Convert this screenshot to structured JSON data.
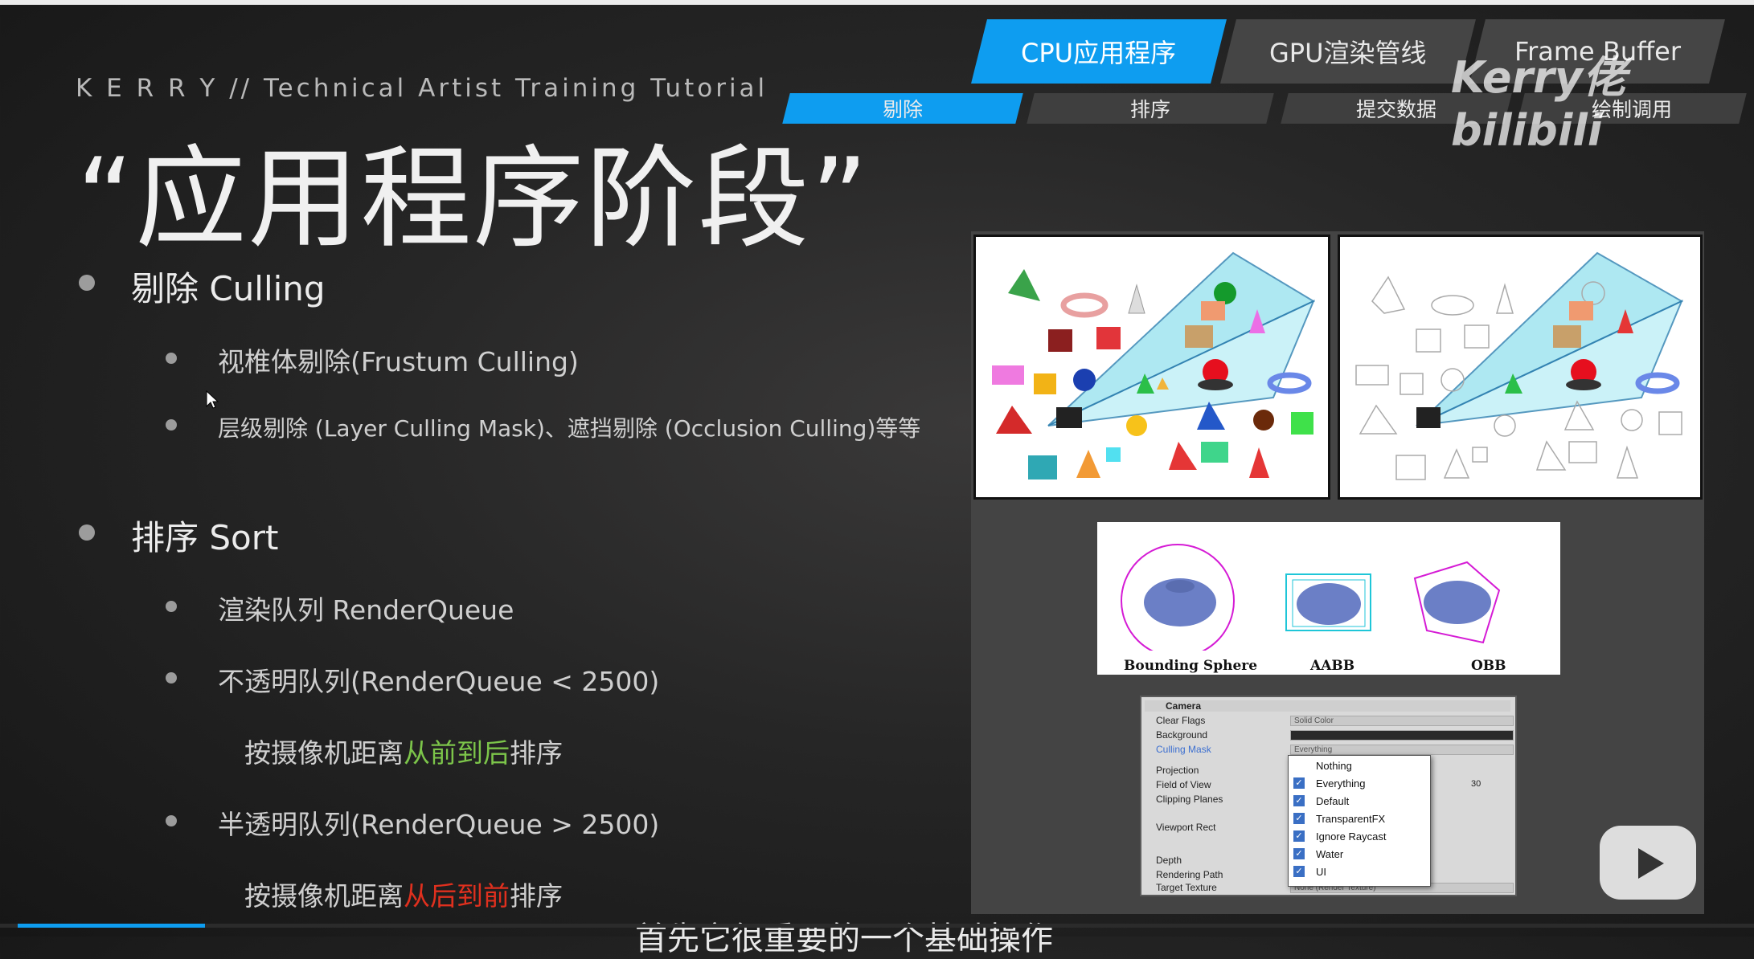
{
  "header": {
    "brand_line": "K E R R Y //  Technical Artist Training Tutorial",
    "title": "“应用程序阶段”",
    "watermark": "Kerry佬 bilibili"
  },
  "tabs": [
    {
      "label": "CPU应用程序",
      "active": true
    },
    {
      "label": "GPU渲染管线",
      "active": false
    },
    {
      "label": "Frame Buffer",
      "active": false
    }
  ],
  "subtabs": [
    {
      "label": "剔除",
      "active": true
    },
    {
      "label": "排序",
      "active": false
    },
    {
      "label": "提交数据",
      "active": false
    },
    {
      "label": "绘制调用",
      "active": false
    }
  ],
  "content": {
    "culling": {
      "heading": "剔除 Culling",
      "items": [
        "视椎体剔除(Frustum Culling)",
        "层级剔除 (Layer Culling Mask)、遮挡剔除 (Occlusion Culling)等等"
      ]
    },
    "sort": {
      "heading": "排序 Sort",
      "render_queue": "渲染队列 RenderQueue",
      "opaque": "不透明队列(RenderQueue < 2500)",
      "opaque_note_pre": "按摄像机距离",
      "opaque_note_hl": "从前到后",
      "opaque_note_post": "排序",
      "transparent": "半透明队列(RenderQueue > 2500)",
      "transparent_note_pre": "按摄像机距离",
      "transparent_note_hl": "从后到前",
      "transparent_note_post": "排序"
    }
  },
  "bounding_volumes": [
    "Bounding Sphere",
    "AABB",
    "OBB"
  ],
  "inspector": {
    "component": "Camera",
    "fields": [
      {
        "label": "Clear Flags",
        "value": "Solid Color"
      },
      {
        "label": "Background",
        "value": ""
      },
      {
        "label": "Culling Mask",
        "value": "Everything"
      },
      {
        "label": "Projection",
        "value": ""
      },
      {
        "label": "Field of View",
        "value": "30"
      },
      {
        "label": "Clipping Planes",
        "value": ""
      },
      {
        "label": "Viewport Rect",
        "value": ""
      },
      {
        "label": "Depth",
        "value": ""
      },
      {
        "label": "Rendering Path",
        "value": ""
      },
      {
        "label": "Target Texture",
        "value": "None (Render Texture)"
      }
    ],
    "dropdown": [
      {
        "label": "Nothing",
        "checked": false
      },
      {
        "label": "Everything",
        "checked": true
      },
      {
        "label": "Default",
        "checked": true
      },
      {
        "label": "TransparentFX",
        "checked": true
      },
      {
        "label": "Ignore Raycast",
        "checked": true
      },
      {
        "label": "Water",
        "checked": true
      },
      {
        "label": "UI",
        "checked": true
      }
    ]
  },
  "subtitle": "首先它很重要的一个基础操作",
  "colors": {
    "accent": "#0e9df0",
    "green_hl": "#7cc54a",
    "red_hl": "#e0301e"
  }
}
